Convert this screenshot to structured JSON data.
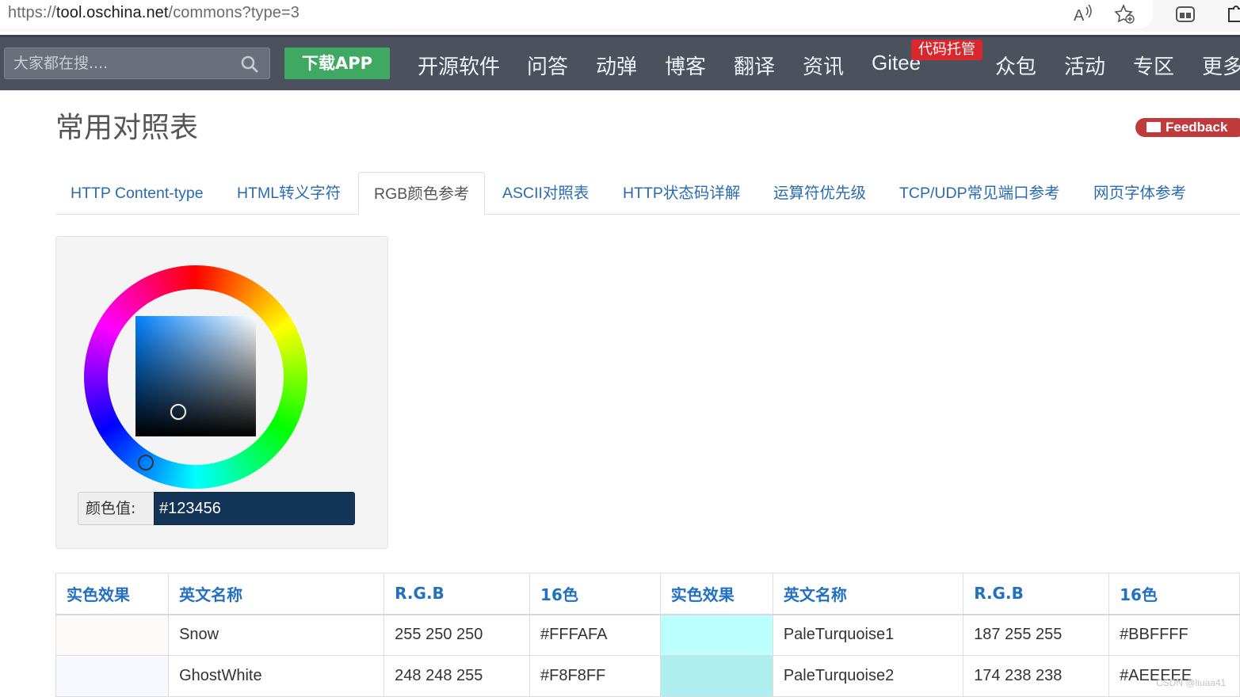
{
  "browser": {
    "url_prefix": "https://",
    "url_host": "tool.oschina.net",
    "url_path": "/commons?type=3",
    "icons": [
      "read-aloud-icon",
      "add-favorite-icon",
      "collections-icon",
      "extensions-icon"
    ]
  },
  "nav": {
    "search_placeholder": "大家都在搜....",
    "download_label": "下载APP",
    "items": [
      "开源软件",
      "问答",
      "动弹",
      "博客",
      "翻译",
      "资讯",
      "Gitee",
      "众包",
      "活动",
      "专区",
      "更多"
    ],
    "gitee_badge": "代码托管"
  },
  "page": {
    "title": "常用对照表",
    "feedback_label": "Feedback"
  },
  "tabs": [
    {
      "label": "HTTP Content-type",
      "active": false
    },
    {
      "label": "HTML转义字符",
      "active": false
    },
    {
      "label": "RGB颜色参考",
      "active": true
    },
    {
      "label": "ASCII对照表",
      "active": false
    },
    {
      "label": "HTTP状态码详解",
      "active": false
    },
    {
      "label": "运算符优先级",
      "active": false
    },
    {
      "label": "TCP/UDP常见端口参考",
      "active": false
    },
    {
      "label": "网页字体参考",
      "active": false
    }
  ],
  "picker": {
    "color_label": "颜色值:",
    "color_value": "#123456"
  },
  "table": {
    "headers": [
      "实色效果",
      "英文名称",
      "R.G.B",
      "16色",
      "实色效果",
      "英文名称",
      "R.G.B",
      "16色"
    ],
    "rows": [
      {
        "swatch1": "#FFFAFA",
        "name1": "Snow",
        "rgb1": "255 250 250",
        "hex1": "#FFFAFA",
        "swatch2": "#BBFFFF",
        "name2": "PaleTurquoise1",
        "rgb2": "187 255 255",
        "hex2": "#BBFFFF"
      },
      {
        "swatch1": "#F8F8FF",
        "name1": "GhostWhite",
        "rgb1": "248 248 255",
        "hex1": "#F8F8FF",
        "swatch2": "#AEEEEE",
        "name2": "PaleTurquoise2",
        "rgb2": "174 238 238",
        "hex2": "#AEEEEE"
      }
    ]
  },
  "watermark": "CSDN @liuaa41"
}
